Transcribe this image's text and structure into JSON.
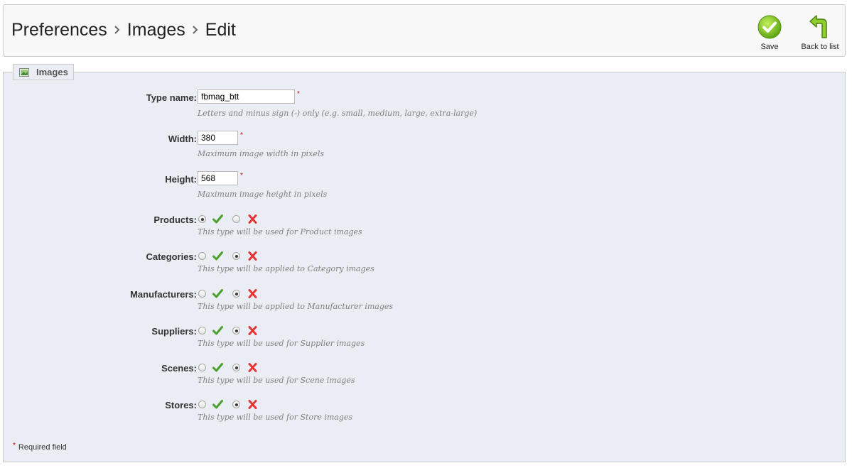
{
  "breadcrumb": [
    "Preferences",
    "Images",
    "Edit"
  ],
  "toolbar": {
    "save_label": "Save",
    "back_label": "Back to list"
  },
  "fieldset": {
    "legend": "Images"
  },
  "fields": {
    "type_name": {
      "label": "Type name:",
      "value": "fbmag_btt",
      "hint": "Letters and minus sign (-) only (e.g. small, medium, large, extra-large)"
    },
    "width": {
      "label": "Width:",
      "value": "380",
      "hint": "Maximum image width in pixels"
    },
    "height": {
      "label": "Height:",
      "value": "568",
      "hint": "Maximum image height in pixels"
    }
  },
  "toggles": [
    {
      "label": "Products:",
      "value": "yes",
      "hint": "This type will be used for Product images"
    },
    {
      "label": "Categories:",
      "value": "no",
      "hint": "This type will be applied to Category images"
    },
    {
      "label": "Manufacturers:",
      "value": "no",
      "hint": "This type will be applied to Manufacturer images"
    },
    {
      "label": "Suppliers:",
      "value": "no",
      "hint": "This type will be used for Supplier images"
    },
    {
      "label": "Scenes:",
      "value": "no",
      "hint": "This type will be used for Scene images"
    },
    {
      "label": "Stores:",
      "value": "no",
      "hint": "This type will be used for Store images"
    }
  ],
  "required_marker": "*",
  "required_note": "Required field",
  "colors": {
    "save_green": "#7cc81c",
    "yes_green": "#4aa02c",
    "no_red": "#e53535",
    "required_red": "#cc0000"
  },
  "icons": {
    "separator": "chevron-right-icon",
    "save": "save-check-icon",
    "back": "back-arrow-icon",
    "legend": "image-icon",
    "yes": "check-icon",
    "no": "cross-icon"
  }
}
